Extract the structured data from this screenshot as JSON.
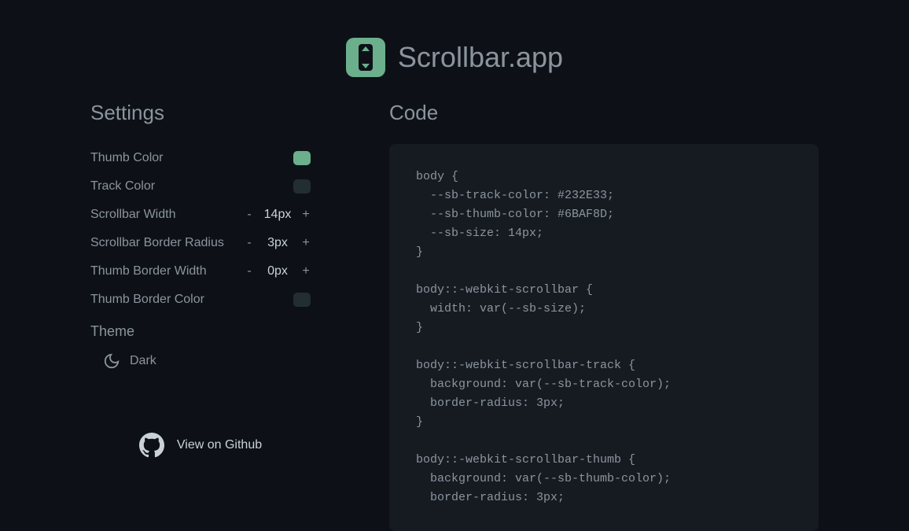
{
  "header": {
    "title": "Scrollbar.app"
  },
  "settings": {
    "title": "Settings",
    "thumbColor": {
      "label": "Thumb Color",
      "value": "#6BAF8D"
    },
    "trackColor": {
      "label": "Track Color",
      "value": "#232E33"
    },
    "scrollbarWidth": {
      "label": "Scrollbar Width",
      "value": "14px"
    },
    "borderRadius": {
      "label": "Scrollbar Border Radius",
      "value": "3px"
    },
    "thumbBorderWidth": {
      "label": "Thumb Border Width",
      "value": "0px"
    },
    "thumbBorderColor": {
      "label": "Thumb Border Color",
      "value": "#232E33"
    }
  },
  "theme": {
    "title": "Theme",
    "current": "Dark"
  },
  "github": {
    "label": "View on Github"
  },
  "code": {
    "title": "Code",
    "content": "body {\n  --sb-track-color: #232E33;\n  --sb-thumb-color: #6BAF8D;\n  --sb-size: 14px;\n}\n\nbody::-webkit-scrollbar {\n  width: var(--sb-size);\n}\n\nbody::-webkit-scrollbar-track {\n  background: var(--sb-track-color);\n  border-radius: 3px;\n}\n\nbody::-webkit-scrollbar-thumb {\n  background: var(--sb-thumb-color);\n  border-radius: 3px;"
  }
}
